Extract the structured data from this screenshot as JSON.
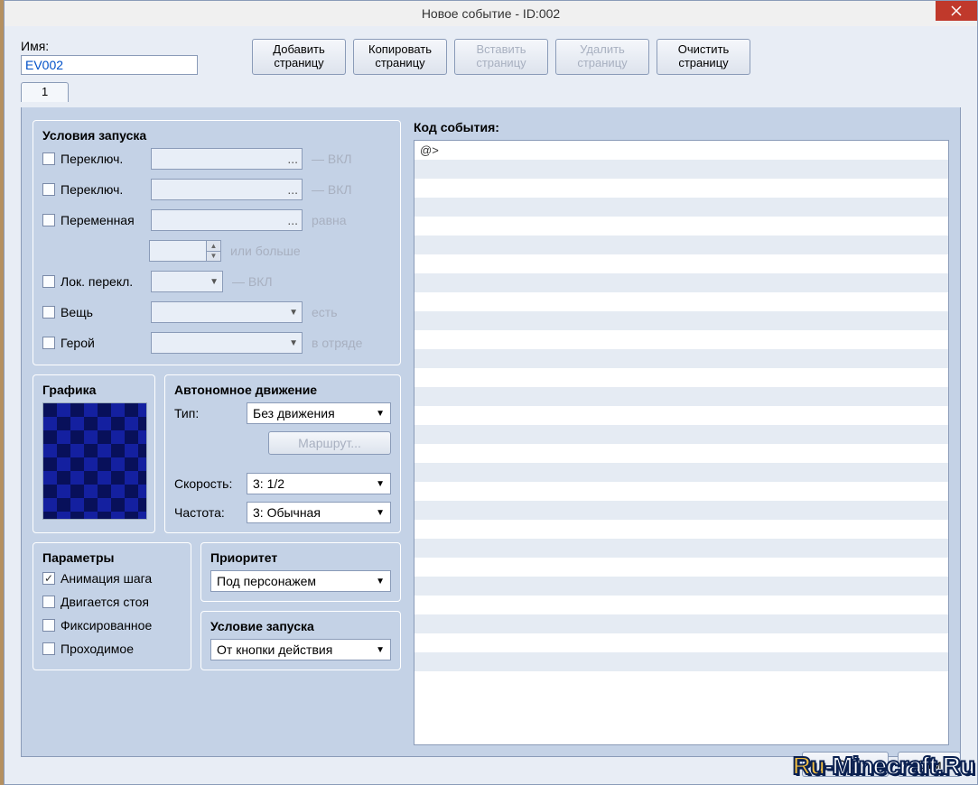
{
  "window": {
    "title": "Новое событие - ID:002"
  },
  "name": {
    "label": "Имя:",
    "value": "EV002"
  },
  "pageButtons": {
    "add": "Добавить страницу",
    "copy": "Копировать страницу",
    "paste": "Вставить страницу",
    "delete": "Удалить страницу",
    "clear": "Очистить страницу"
  },
  "tab": {
    "label": "1"
  },
  "conditions": {
    "title": "Условия запуска",
    "switch1": {
      "label": "Переключ.",
      "suffix": "— ВКЛ"
    },
    "switch2": {
      "label": "Переключ.",
      "suffix": "— ВКЛ"
    },
    "variable": {
      "label": "Переменная",
      "suffix": "равна",
      "suffix2": "или больше"
    },
    "selfswitch": {
      "label": "Лок. перекл.",
      "suffix": "— ВКЛ"
    },
    "item": {
      "label": "Вещь",
      "suffix": "есть"
    },
    "actor": {
      "label": "Герой",
      "suffix": "в отряде"
    }
  },
  "graphic": {
    "title": "Графика"
  },
  "automove": {
    "title": "Автономное движение",
    "typeLabel": "Тип:",
    "typeValue": "Без движения",
    "routeBtn": "Маршрут...",
    "speedLabel": "Скорость:",
    "speedValue": "3: 1/2",
    "freqLabel": "Частота:",
    "freqValue": "3: Обычная"
  },
  "params": {
    "title": "Параметры",
    "step": "Анимация шага",
    "walk": "Двигается стоя",
    "fixed": "Фиксированное",
    "through": "Проходимое"
  },
  "priority": {
    "title": "Приоритет",
    "value": "Под персонажем"
  },
  "trigger": {
    "title": "Условие запуска",
    "value": "От кнопки действия"
  },
  "code": {
    "label": "Код события:",
    "first": "@>"
  },
  "footer": {
    "ok": "OK",
    "cancel": "Отм"
  },
  "watermark": {
    "p1": "Ru",
    "p2": "-Minecraft.Ru"
  }
}
